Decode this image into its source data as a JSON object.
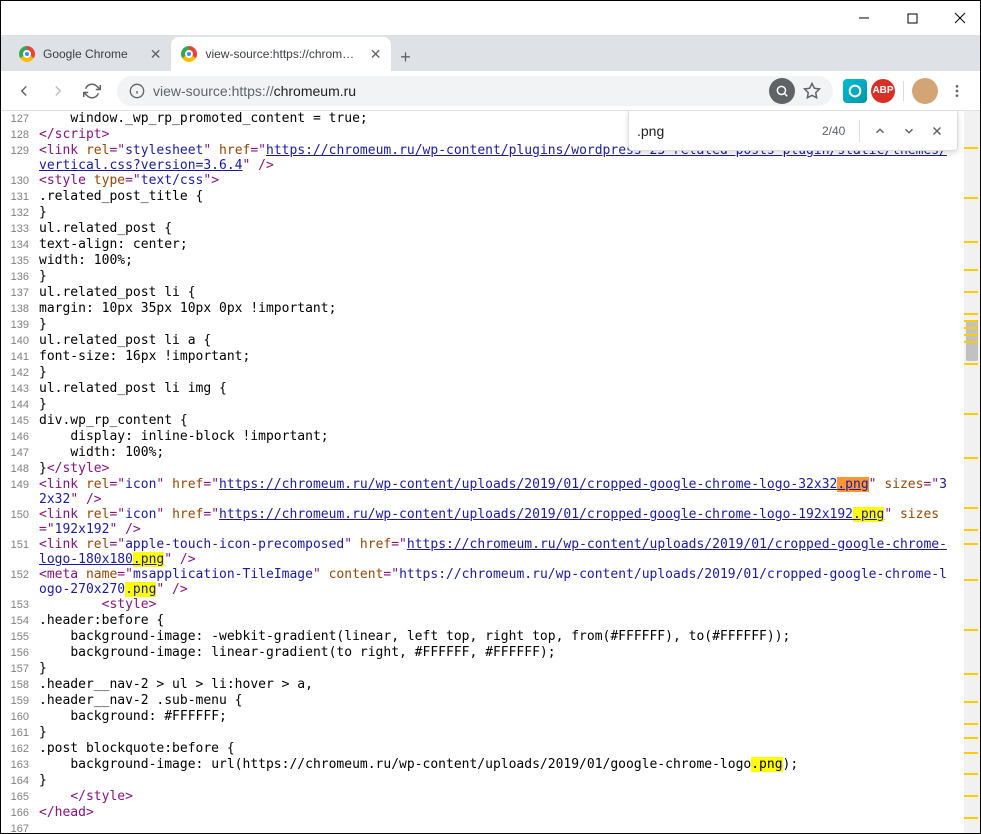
{
  "tabs": [
    {
      "title": "Google Chrome",
      "active": false
    },
    {
      "title": "view-source:https://chromeum.ru",
      "active": true
    }
  ],
  "url_prefix": "view-source:https://",
  "url_host": "chromeum.ru",
  "find": {
    "query": ".png",
    "result": "2/40"
  },
  "lines": [
    {
      "n": 127,
      "parts": [
        {
          "t": "    window._wp_rp_promoted_content = true;",
          "c": "text-content"
        }
      ]
    },
    {
      "n": 128,
      "parts": [
        {
          "t": "</script",
          "c": "tag-bracket"
        },
        {
          "t": ">",
          "c": "tag-bracket"
        }
      ]
    },
    {
      "n": 129,
      "parts": [
        {
          "t": "<link ",
          "c": "tag-bracket"
        },
        {
          "t": "rel",
          "c": "attr-name"
        },
        {
          "t": "=\"",
          "c": "tag-bracket"
        },
        {
          "t": "stylesheet",
          "c": "attr-val"
        },
        {
          "t": "\" ",
          "c": "tag-bracket"
        },
        {
          "t": "href",
          "c": "attr-name"
        },
        {
          "t": "=\"",
          "c": "tag-bracket"
        },
        {
          "t": "https://chromeum.ru/wp-content/plugins/wordpress-23-related-posts-plugin/static/themes/vertical.css?version=3.6.4",
          "c": "link-val"
        },
        {
          "t": "\" />",
          "c": "tag-bracket"
        }
      ]
    },
    {
      "n": 130,
      "parts": [
        {
          "t": "<style ",
          "c": "tag-bracket"
        },
        {
          "t": "type",
          "c": "attr-name"
        },
        {
          "t": "=\"",
          "c": "tag-bracket"
        },
        {
          "t": "text/css",
          "c": "attr-val"
        },
        {
          "t": "\">",
          "c": "tag-bracket"
        }
      ]
    },
    {
      "n": 131,
      "parts": [
        {
          "t": ".related_post_title {",
          "c": "text-content"
        }
      ]
    },
    {
      "n": 132,
      "parts": [
        {
          "t": "}",
          "c": "text-content"
        }
      ]
    },
    {
      "n": 133,
      "parts": [
        {
          "t": "ul.related_post {",
          "c": "text-content"
        }
      ]
    },
    {
      "n": 134,
      "parts": [
        {
          "t": "text-align: center;",
          "c": "text-content"
        }
      ]
    },
    {
      "n": 135,
      "parts": [
        {
          "t": "width: 100%;",
          "c": "text-content"
        }
      ]
    },
    {
      "n": 136,
      "parts": [
        {
          "t": "}",
          "c": "text-content"
        }
      ]
    },
    {
      "n": 137,
      "parts": [
        {
          "t": "ul.related_post li {",
          "c": "text-content"
        }
      ]
    },
    {
      "n": 138,
      "parts": [
        {
          "t": "margin: 10px 35px 10px 0px !important;",
          "c": "text-content"
        }
      ]
    },
    {
      "n": 139,
      "parts": [
        {
          "t": "}",
          "c": "text-content"
        }
      ]
    },
    {
      "n": 140,
      "parts": [
        {
          "t": "ul.related_post li a {",
          "c": "text-content"
        }
      ]
    },
    {
      "n": 141,
      "parts": [
        {
          "t": "font-size: 16px !important;",
          "c": "text-content"
        }
      ]
    },
    {
      "n": 142,
      "parts": [
        {
          "t": "}",
          "c": "text-content"
        }
      ]
    },
    {
      "n": 143,
      "parts": [
        {
          "t": "ul.related_post li img {",
          "c": "text-content"
        }
      ]
    },
    {
      "n": 144,
      "parts": [
        {
          "t": "}",
          "c": "text-content"
        }
      ]
    },
    {
      "n": 145,
      "parts": [
        {
          "t": "div.wp_rp_content {",
          "c": "text-content"
        }
      ]
    },
    {
      "n": 146,
      "parts": [
        {
          "t": "    display: inline-block !important;",
          "c": "text-content"
        }
      ]
    },
    {
      "n": 147,
      "parts": [
        {
          "t": "    width: 100%;",
          "c": "text-content"
        }
      ]
    },
    {
      "n": 148,
      "parts": [
        {
          "t": "}",
          "c": "text-content"
        },
        {
          "t": "</style>",
          "c": "tag-bracket"
        }
      ]
    },
    {
      "n": 149,
      "parts": [
        {
          "t": "<link ",
          "c": "tag-bracket"
        },
        {
          "t": "rel",
          "c": "attr-name"
        },
        {
          "t": "=\"",
          "c": "tag-bracket"
        },
        {
          "t": "icon",
          "c": "attr-val"
        },
        {
          "t": "\" ",
          "c": "tag-bracket"
        },
        {
          "t": "href",
          "c": "attr-name"
        },
        {
          "t": "=\"",
          "c": "tag-bracket"
        },
        {
          "t": "https://chromeum.ru/wp-content/uploads/2019/01/cropped-google-chrome-logo-32x32",
          "c": "link-val"
        },
        {
          "t": ".png",
          "c": "link-val hl-orange"
        },
        {
          "t": "\" ",
          "c": "tag-bracket"
        },
        {
          "t": "sizes",
          "c": "attr-name"
        },
        {
          "t": "=\"",
          "c": "tag-bracket"
        },
        {
          "t": "32x32",
          "c": "attr-val"
        },
        {
          "t": "\" />",
          "c": "tag-bracket"
        }
      ]
    },
    {
      "n": 150,
      "parts": [
        {
          "t": "<link ",
          "c": "tag-bracket"
        },
        {
          "t": "rel",
          "c": "attr-name"
        },
        {
          "t": "=\"",
          "c": "tag-bracket"
        },
        {
          "t": "icon",
          "c": "attr-val"
        },
        {
          "t": "\" ",
          "c": "tag-bracket"
        },
        {
          "t": "href",
          "c": "attr-name"
        },
        {
          "t": "=\"",
          "c": "tag-bracket"
        },
        {
          "t": "https://chromeum.ru/wp-content/uploads/2019/01/cropped-google-chrome-logo-192x192",
          "c": "link-val"
        },
        {
          "t": ".png",
          "c": "link-val hl-yellow"
        },
        {
          "t": "\" ",
          "c": "tag-bracket"
        },
        {
          "t": "sizes",
          "c": "attr-name"
        },
        {
          "t": "=\"",
          "c": "tag-bracket"
        },
        {
          "t": "192x192",
          "c": "attr-val"
        },
        {
          "t": "\" />",
          "c": "tag-bracket"
        }
      ]
    },
    {
      "n": 151,
      "parts": [
        {
          "t": "<link ",
          "c": "tag-bracket"
        },
        {
          "t": "rel",
          "c": "attr-name"
        },
        {
          "t": "=\"",
          "c": "tag-bracket"
        },
        {
          "t": "apple-touch-icon-precomposed",
          "c": "attr-val"
        },
        {
          "t": "\" ",
          "c": "tag-bracket"
        },
        {
          "t": "href",
          "c": "attr-name"
        },
        {
          "t": "=\"",
          "c": "tag-bracket"
        },
        {
          "t": "https://chromeum.ru/wp-content/uploads/2019/01/cropped-google-chrome-logo-180x180",
          "c": "link-val"
        },
        {
          "t": ".png",
          "c": "link-val hl-yellow"
        },
        {
          "t": "\" />",
          "c": "tag-bracket"
        }
      ]
    },
    {
      "n": 152,
      "parts": [
        {
          "t": "<meta ",
          "c": "tag-bracket"
        },
        {
          "t": "name",
          "c": "attr-name"
        },
        {
          "t": "=\"",
          "c": "tag-bracket"
        },
        {
          "t": "msapplication-TileImage",
          "c": "attr-val"
        },
        {
          "t": "\" ",
          "c": "tag-bracket"
        },
        {
          "t": "content",
          "c": "attr-name"
        },
        {
          "t": "=\"",
          "c": "tag-bracket"
        },
        {
          "t": "https://chromeum.ru/wp-content/uploads/2019/01/cropped-google-chrome-logo-270x270",
          "c": "attr-val"
        },
        {
          "t": ".png",
          "c": "attr-val hl-yellow"
        },
        {
          "t": "\" />",
          "c": "tag-bracket"
        }
      ]
    },
    {
      "n": 153,
      "parts": [
        {
          "t": "        ",
          "c": "text-content"
        },
        {
          "t": "<style>",
          "c": "tag-bracket"
        }
      ]
    },
    {
      "n": 154,
      "parts": [
        {
          "t": ".header:before {",
          "c": "text-content"
        }
      ]
    },
    {
      "n": 155,
      "parts": [
        {
          "t": "    background-image: -webkit-gradient(linear, left top, right top, from(#FFFFFF), to(#FFFFFF));",
          "c": "text-content"
        }
      ]
    },
    {
      "n": 156,
      "parts": [
        {
          "t": "    background-image: linear-gradient(to right, #FFFFFF, #FFFFFF);",
          "c": "text-content"
        }
      ]
    },
    {
      "n": 157,
      "parts": [
        {
          "t": "}",
          "c": "text-content"
        }
      ]
    },
    {
      "n": 158,
      "parts": [
        {
          "t": ".header__nav-2 > ul > li:hover > a,",
          "c": "text-content"
        }
      ]
    },
    {
      "n": 159,
      "parts": [
        {
          "t": ".header__nav-2 .sub-menu {",
          "c": "text-content"
        }
      ]
    },
    {
      "n": 160,
      "parts": [
        {
          "t": "    background: #FFFFFF;",
          "c": "text-content"
        }
      ]
    },
    {
      "n": 161,
      "parts": [
        {
          "t": "}",
          "c": "text-content"
        }
      ]
    },
    {
      "n": 162,
      "parts": [
        {
          "t": ".post blockquote:before {",
          "c": "text-content"
        }
      ]
    },
    {
      "n": 163,
      "parts": [
        {
          "t": "    background-image: url(https://chromeum.ru/wp-content/uploads/2019/01/google-chrome-logo",
          "c": "text-content"
        },
        {
          "t": ".png",
          "c": "text-content hl-yellow"
        },
        {
          "t": ");",
          "c": "text-content"
        }
      ]
    },
    {
      "n": 164,
      "parts": [
        {
          "t": "}",
          "c": "text-content"
        }
      ]
    },
    {
      "n": 165,
      "parts": [
        {
          "t": "    ",
          "c": "text-content"
        },
        {
          "t": "</style>",
          "c": "tag-bracket"
        }
      ]
    },
    {
      "n": 166,
      "parts": [
        {
          "t": "</head>",
          "c": "tag-bracket"
        }
      ]
    },
    {
      "n": 167,
      "parts": [
        {
          "t": " ",
          "c": "text-content"
        }
      ]
    }
  ],
  "scroll_marks": [
    5,
    12,
    18,
    22,
    25,
    28,
    29,
    30,
    31,
    32,
    35,
    42,
    48,
    55,
    58,
    60,
    65,
    72,
    78,
    82,
    85,
    87,
    89,
    92,
    95,
    98
  ]
}
